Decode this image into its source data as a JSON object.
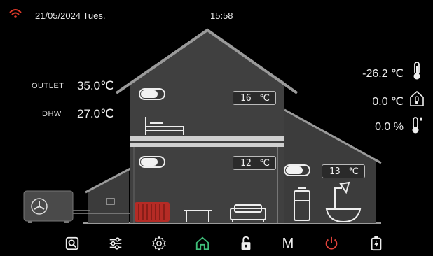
{
  "status": {
    "date": "21/05/2024 Tues.",
    "time": "15:58"
  },
  "left_readings": {
    "outlet_label": "OUTLET",
    "outlet_value": "35.0℃",
    "dhw_label": "DHW",
    "dhw_value": "27.0℃"
  },
  "right_readings": {
    "outdoor_temp": "-26.2 ℃",
    "indoor_temp": "0.0 ℃",
    "humidity": "0.0 %"
  },
  "zones": [
    {
      "name": "upper-zone",
      "setpoint": "16",
      "unit": "℃",
      "on": true
    },
    {
      "name": "middle-zone",
      "setpoint": "12",
      "unit": "℃",
      "on": true
    },
    {
      "name": "right-zone",
      "setpoint": "13",
      "unit": "℃",
      "on": true
    }
  ],
  "nav": {
    "items": [
      "search-icon",
      "sliders-icon",
      "gear-icon",
      "home-icon",
      "unlock-icon",
      "mode-letter",
      "power-icon",
      "battery-charge-icon"
    ],
    "mode_label": "M"
  },
  "colors": {
    "wall": "#3f3f3f",
    "roof_edge": "#9a9a9a",
    "home_active": "#3fbf7a",
    "power": "#e0423a",
    "radiator": "#c0302a",
    "wifi": "#e03a2a"
  }
}
